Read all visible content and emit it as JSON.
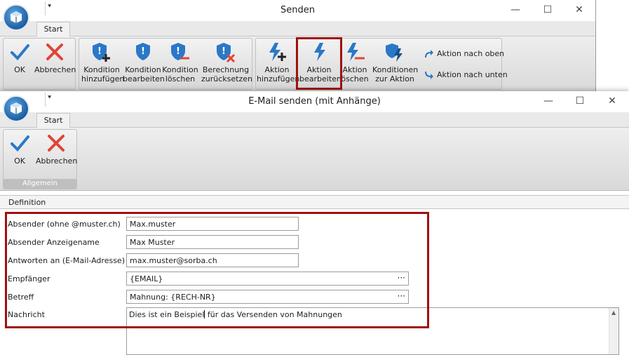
{
  "back_window": {
    "title": "Senden",
    "tab": "Start",
    "buttons": {
      "ok": "OK",
      "abbrechen": "Abbrechen",
      "kond_add_1": "Kondition",
      "kond_add_2": "hinzufügen",
      "kond_edit_1": "Kondition",
      "kond_edit_2": "bearbeiten",
      "kond_del_1": "Kondition",
      "kond_del_2": "löschen",
      "calc_reset_1": "Berechnung",
      "calc_reset_2": "zurücksetzen",
      "act_add_1": "Aktion",
      "act_add_2": "hinzufügen",
      "act_edit_1": "Aktion",
      "act_edit_2": "bearbeiten",
      "act_del_1": "Aktion",
      "act_del_2": "öschen",
      "cond_to_act_1": "Konditionen",
      "cond_to_act_2": "zur Aktion",
      "act_up": "Aktion nach oben",
      "act_down": "Aktion nach unten"
    }
  },
  "front_window": {
    "title": "E-Mail senden (mit Anhänge)",
    "tab": "Start",
    "buttons": {
      "ok": "OK",
      "abbrechen": "Abbrechen"
    },
    "group_label": "Allgemein",
    "section": "Definition",
    "form": {
      "absender_label": "Absender (ohne @muster.ch)",
      "absender_value": "Max.muster",
      "anzeige_label": "Absender Anzeigename",
      "anzeige_value": "Max Muster",
      "antwort_label": "Antworten an (E-Mail-Adresse)",
      "antwort_value": "max.muster@sorba.ch",
      "empf_label": "Empfänger",
      "empf_value": "{EMAIL}",
      "betreff_label": "Betreff",
      "betreff_value": "Mahnung: {RECH-NR}",
      "nachricht_label": "Nachricht",
      "nachricht_before": "Dies ist ein Beispiel",
      "nachricht_after": " für das Versenden von Mahnungen",
      "ellipsis": "···"
    }
  },
  "window_controls": {
    "minimize": "—",
    "maximize": "☐",
    "close": "✕"
  },
  "qat_glyph": "⯆",
  "colors": {
    "highlight": "#a01010",
    "ok_blue": "#2a78c8",
    "cancel_red": "#e0443a",
    "icon_blue": "#2a78c8"
  },
  "icons": [
    "app-logo-icon",
    "checkmark-icon",
    "cross-icon",
    "shield-plus-icon",
    "shield-edit-icon",
    "shield-minus-icon",
    "shield-x-icon",
    "bolt-plus-icon",
    "bolt-icon",
    "bolt-minus-icon",
    "bolt-shield-icon",
    "arrow-up-icon",
    "arrow-down-icon"
  ]
}
